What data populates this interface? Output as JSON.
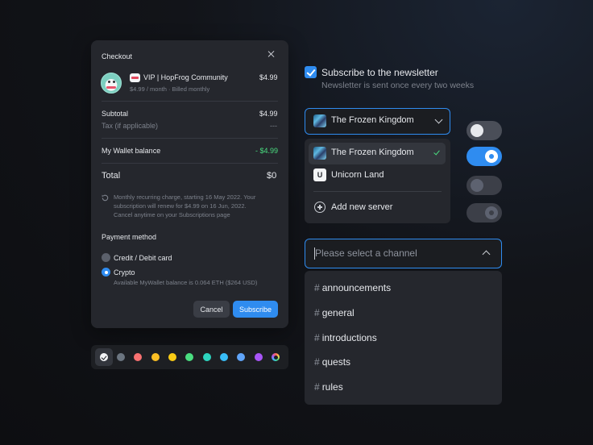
{
  "checkout": {
    "title": "Checkout",
    "product_name": "VIP | HopFrog Community",
    "product_price": "$4.99",
    "product_billing": "$4.99 / month · Billed monthly",
    "subtotal_label": "Subtotal",
    "subtotal_value": "$4.99",
    "tax_label": "Tax (if applicable)",
    "tax_value": "---",
    "wallet_label": "My Wallet balance",
    "wallet_value": "- $4.99",
    "total_label": "Total",
    "total_value": "$0",
    "note_line1": "Monthly recurring charge, starting 16 May 2022. Your",
    "note_line2": "subscription will renew for $4.99 on 16 Jun, 2022.",
    "note_line3": "Cancel anytime on your Subscriptions page",
    "payment_title": "Payment method",
    "payment_options": [
      {
        "label": "Credit / Debit card",
        "selected": false
      },
      {
        "label": "Crypto",
        "selected": true
      }
    ],
    "crypto_note": "Available MyWallet balance is 0.064 ETH ($264 USD)",
    "cancel_label": "Cancel",
    "subscribe_label": "Subscribe"
  },
  "colors": {
    "swatches": [
      "#f3f4f6",
      "#6b7580",
      "#f87171",
      "#fbbf24",
      "#facc15",
      "#4ade80",
      "#2dd4bf",
      "#38bdf8",
      "#60a5fa",
      "#a855f7",
      "rainbow"
    ],
    "selected_index": 0
  },
  "newsletter": {
    "checked": true,
    "label": "Subscribe to the newsletter",
    "sublabel": "Newsletter is sent once every two weeks"
  },
  "server_select": {
    "selected": "The Frozen Kingdom",
    "options": [
      {
        "label": "The Frozen Kingdom",
        "icon": "frozen-kingdom-icon",
        "selected": true
      },
      {
        "label": "Unicorn Land",
        "icon_letter": "U",
        "selected": false
      }
    ],
    "add_label": "Add new server"
  },
  "toggles": [
    {
      "state": "off"
    },
    {
      "state": "on"
    },
    {
      "state": "off-disabled"
    },
    {
      "state": "on-disabled"
    }
  ],
  "channel_select": {
    "placeholder": "Please select a channel",
    "channels": [
      "announcements",
      "general",
      "introductions",
      "quests",
      "rules"
    ]
  },
  "accent_color": "#2f8cf0"
}
